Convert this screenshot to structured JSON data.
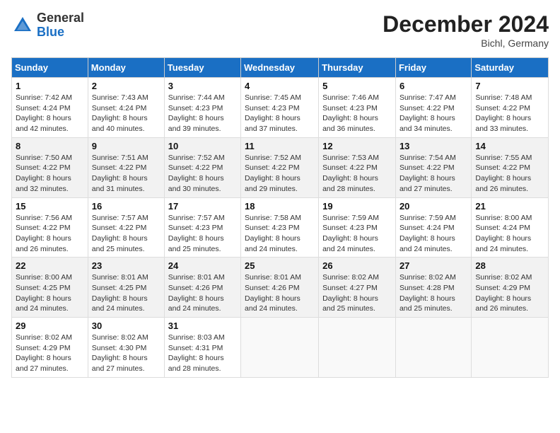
{
  "header": {
    "logo_general": "General",
    "logo_blue": "Blue",
    "month_title": "December 2024",
    "location": "Bichl, Germany"
  },
  "days_of_week": [
    "Sunday",
    "Monday",
    "Tuesday",
    "Wednesday",
    "Thursday",
    "Friday",
    "Saturday"
  ],
  "weeks": [
    [
      {
        "day": "1",
        "sunrise": "7:42 AM",
        "sunset": "4:24 PM",
        "daylight": "8 hours and 42 minutes."
      },
      {
        "day": "2",
        "sunrise": "7:43 AM",
        "sunset": "4:24 PM",
        "daylight": "8 hours and 40 minutes."
      },
      {
        "day": "3",
        "sunrise": "7:44 AM",
        "sunset": "4:23 PM",
        "daylight": "8 hours and 39 minutes."
      },
      {
        "day": "4",
        "sunrise": "7:45 AM",
        "sunset": "4:23 PM",
        "daylight": "8 hours and 37 minutes."
      },
      {
        "day": "5",
        "sunrise": "7:46 AM",
        "sunset": "4:23 PM",
        "daylight": "8 hours and 36 minutes."
      },
      {
        "day": "6",
        "sunrise": "7:47 AM",
        "sunset": "4:22 PM",
        "daylight": "8 hours and 34 minutes."
      },
      {
        "day": "7",
        "sunrise": "7:48 AM",
        "sunset": "4:22 PM",
        "daylight": "8 hours and 33 minutes."
      }
    ],
    [
      {
        "day": "8",
        "sunrise": "7:50 AM",
        "sunset": "4:22 PM",
        "daylight": "8 hours and 32 minutes."
      },
      {
        "day": "9",
        "sunrise": "7:51 AM",
        "sunset": "4:22 PM",
        "daylight": "8 hours and 31 minutes."
      },
      {
        "day": "10",
        "sunrise": "7:52 AM",
        "sunset": "4:22 PM",
        "daylight": "8 hours and 30 minutes."
      },
      {
        "day": "11",
        "sunrise": "7:52 AM",
        "sunset": "4:22 PM",
        "daylight": "8 hours and 29 minutes."
      },
      {
        "day": "12",
        "sunrise": "7:53 AM",
        "sunset": "4:22 PM",
        "daylight": "8 hours and 28 minutes."
      },
      {
        "day": "13",
        "sunrise": "7:54 AM",
        "sunset": "4:22 PM",
        "daylight": "8 hours and 27 minutes."
      },
      {
        "day": "14",
        "sunrise": "7:55 AM",
        "sunset": "4:22 PM",
        "daylight": "8 hours and 26 minutes."
      }
    ],
    [
      {
        "day": "15",
        "sunrise": "7:56 AM",
        "sunset": "4:22 PM",
        "daylight": "8 hours and 26 minutes."
      },
      {
        "day": "16",
        "sunrise": "7:57 AM",
        "sunset": "4:22 PM",
        "daylight": "8 hours and 25 minutes."
      },
      {
        "day": "17",
        "sunrise": "7:57 AM",
        "sunset": "4:23 PM",
        "daylight": "8 hours and 25 minutes."
      },
      {
        "day": "18",
        "sunrise": "7:58 AM",
        "sunset": "4:23 PM",
        "daylight": "8 hours and 24 minutes."
      },
      {
        "day": "19",
        "sunrise": "7:59 AM",
        "sunset": "4:23 PM",
        "daylight": "8 hours and 24 minutes."
      },
      {
        "day": "20",
        "sunrise": "7:59 AM",
        "sunset": "4:24 PM",
        "daylight": "8 hours and 24 minutes."
      },
      {
        "day": "21",
        "sunrise": "8:00 AM",
        "sunset": "4:24 PM",
        "daylight": "8 hours and 24 minutes."
      }
    ],
    [
      {
        "day": "22",
        "sunrise": "8:00 AM",
        "sunset": "4:25 PM",
        "daylight": "8 hours and 24 minutes."
      },
      {
        "day": "23",
        "sunrise": "8:01 AM",
        "sunset": "4:25 PM",
        "daylight": "8 hours and 24 minutes."
      },
      {
        "day": "24",
        "sunrise": "8:01 AM",
        "sunset": "4:26 PM",
        "daylight": "8 hours and 24 minutes."
      },
      {
        "day": "25",
        "sunrise": "8:01 AM",
        "sunset": "4:26 PM",
        "daylight": "8 hours and 24 minutes."
      },
      {
        "day": "26",
        "sunrise": "8:02 AM",
        "sunset": "4:27 PM",
        "daylight": "8 hours and 25 minutes."
      },
      {
        "day": "27",
        "sunrise": "8:02 AM",
        "sunset": "4:28 PM",
        "daylight": "8 hours and 25 minutes."
      },
      {
        "day": "28",
        "sunrise": "8:02 AM",
        "sunset": "4:29 PM",
        "daylight": "8 hours and 26 minutes."
      }
    ],
    [
      {
        "day": "29",
        "sunrise": "8:02 AM",
        "sunset": "4:29 PM",
        "daylight": "8 hours and 27 minutes."
      },
      {
        "day": "30",
        "sunrise": "8:02 AM",
        "sunset": "4:30 PM",
        "daylight": "8 hours and 27 minutes."
      },
      {
        "day": "31",
        "sunrise": "8:03 AM",
        "sunset": "4:31 PM",
        "daylight": "8 hours and 28 minutes."
      },
      null,
      null,
      null,
      null
    ]
  ],
  "labels": {
    "sunrise": "Sunrise:",
    "sunset": "Sunset:",
    "daylight": "Daylight:"
  }
}
